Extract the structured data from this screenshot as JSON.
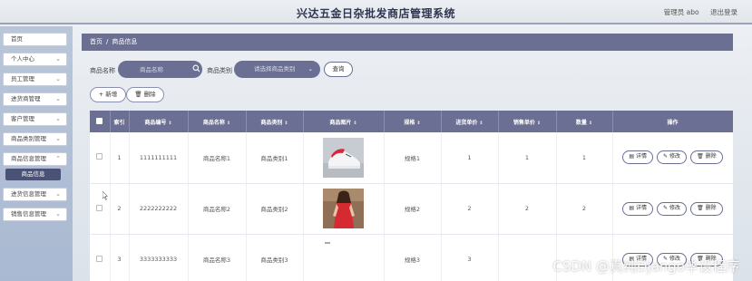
{
  "header": {
    "title": "兴达五金日杂批发商店管理系统",
    "user_label": "管理员 abo",
    "logout_label": "退出登录"
  },
  "sidebar": {
    "items": [
      {
        "label": "首页",
        "has_chevron": false
      },
      {
        "label": "个人中心",
        "has_chevron": true
      },
      {
        "label": "员工管理",
        "has_chevron": true
      },
      {
        "label": "进货商管理",
        "has_chevron": true
      },
      {
        "label": "客户管理",
        "has_chevron": true
      },
      {
        "label": "商品类别管理",
        "has_chevron": true
      },
      {
        "label": "商品信息管理",
        "has_chevron": true
      },
      {
        "label": "进货信息管理",
        "has_chevron": true
      },
      {
        "label": "销售信息管理",
        "has_chevron": true
      }
    ],
    "active_sub": "商品信息"
  },
  "breadcrumb": {
    "home": "首页",
    "separator": "/",
    "current": "商品信息"
  },
  "search": {
    "name_label": "商品名称",
    "name_placeholder": "商品名称",
    "category_label": "商品类别",
    "category_placeholder": "请选择商品类别",
    "query_label": "查询"
  },
  "actions": {
    "add_label": "+ 新增",
    "delete_label": "删除"
  },
  "table": {
    "columns": [
      "索引",
      "商品编号",
      "商品名称",
      "商品类别",
      "商品图片",
      "规格",
      "进货单价",
      "销售单价",
      "数量",
      "操作"
    ],
    "rows": [
      {
        "index": "1",
        "code": "1111111111",
        "name": "商品名称1",
        "category": "商品类别1",
        "image": "white-sneaker",
        "spec": "规格1",
        "purchase_price": "1",
        "sale_price": "1",
        "qty": "1"
      },
      {
        "index": "2",
        "code": "2222222222",
        "name": "商品名称2",
        "category": "商品类别2",
        "image": "red-dress",
        "spec": "规格2",
        "purchase_price": "2",
        "sale_price": "2",
        "qty": "2"
      },
      {
        "index": "3",
        "code": "3333333333",
        "name": "商品名称3",
        "category": "商品类别3",
        "image": "",
        "spec": "规格3",
        "purchase_price": "3",
        "sale_price": "",
        "qty": ""
      }
    ],
    "row_ops": {
      "detail": "详情",
      "edit": "修改",
      "delete": "删除"
    }
  },
  "watermark": "CSDN @真纯Django毕设程序",
  "colors": {
    "primary": "#6b6f93",
    "sidebar": "#b1c0d6",
    "header_border": "#9aa3b5"
  }
}
